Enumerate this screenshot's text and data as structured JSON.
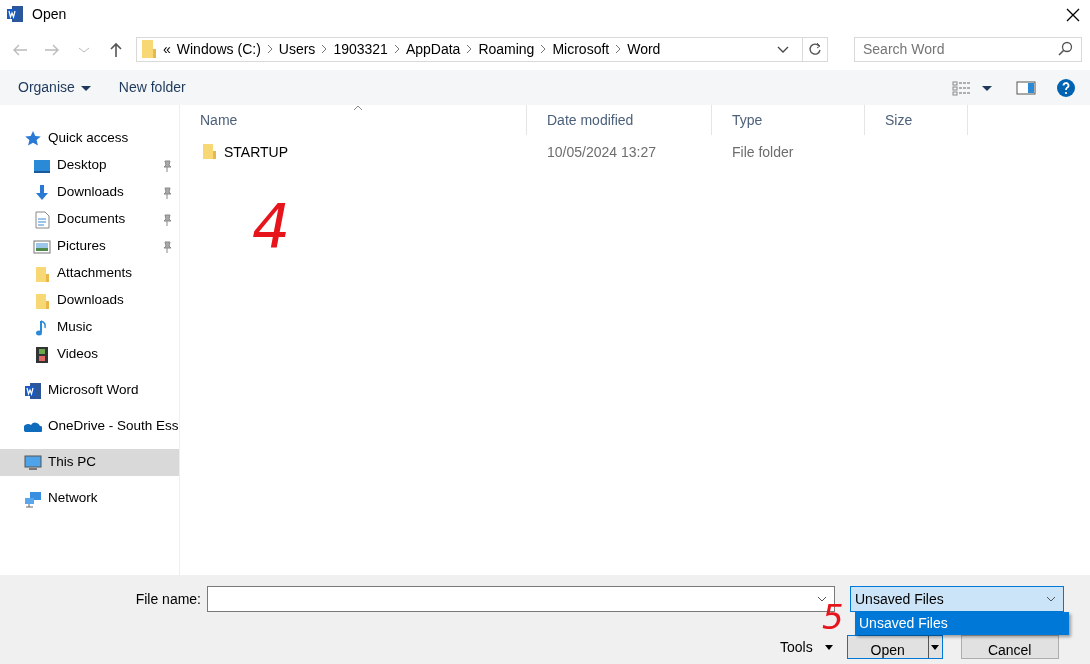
{
  "window": {
    "title": "Open"
  },
  "address": {
    "overflow": "«",
    "segments": [
      "Windows (C:)",
      "Users",
      "1903321",
      "AppData",
      "Roaming",
      "Microsoft",
      "Word"
    ]
  },
  "search": {
    "placeholder": "Search Word"
  },
  "toolbar": {
    "organise": "Organise",
    "new_folder": "New folder"
  },
  "sidebar": {
    "items": [
      {
        "label": "Quick access",
        "kind": "star",
        "selected": false,
        "children": [
          {
            "label": "Desktop",
            "kind": "desktop",
            "pinned": true,
            "selected": false
          },
          {
            "label": "Downloads",
            "kind": "download",
            "pinned": true,
            "selected": false
          },
          {
            "label": "Documents",
            "kind": "document",
            "pinned": true,
            "selected": false
          },
          {
            "label": "Pictures",
            "kind": "pictures",
            "pinned": true,
            "selected": false
          },
          {
            "label": "Attachments",
            "kind": "folder",
            "pinned": false,
            "selected": false
          },
          {
            "label": "Downloads",
            "kind": "folder",
            "pinned": false,
            "selected": false
          },
          {
            "label": "Music",
            "kind": "music",
            "pinned": false,
            "selected": false
          },
          {
            "label": "Videos",
            "kind": "video",
            "pinned": false,
            "selected": false
          }
        ]
      },
      {
        "label": "Microsoft Word",
        "kind": "word",
        "selected": false
      },
      {
        "label": "OneDrive - South Ess",
        "kind": "cloud",
        "selected": false
      },
      {
        "label": "This PC",
        "kind": "pc",
        "selected": true
      },
      {
        "label": "Network",
        "kind": "network",
        "selected": false
      }
    ]
  },
  "table": {
    "columns": [
      {
        "label": "Name",
        "sorted": true
      },
      {
        "label": "Date modified",
        "sorted": false
      },
      {
        "label": "Type",
        "sorted": false
      },
      {
        "label": "Size",
        "sorted": false
      }
    ],
    "rows": [
      {
        "name": "STARTUP",
        "date": "10/05/2024 13:27",
        "type": "File folder"
      }
    ]
  },
  "footer": {
    "file_name_label": "File name:",
    "file_type": {
      "value": "Unsaved Files",
      "expanded": true,
      "options": [
        {
          "label": "Unsaved Files",
          "selected": true
        }
      ]
    },
    "tools": "Tools",
    "open": "Open",
    "cancel": "Cancel"
  },
  "annotations": [
    {
      "text": "4"
    },
    {
      "text": "5"
    }
  ]
}
